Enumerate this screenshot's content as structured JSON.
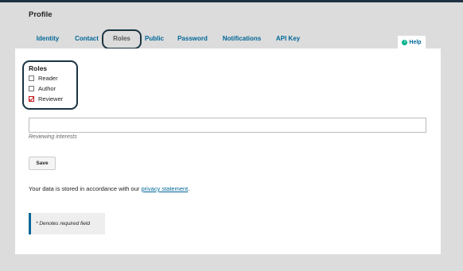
{
  "page": {
    "title": "Profile"
  },
  "tabs": [
    {
      "label": "Identity",
      "active": false
    },
    {
      "label": "Contact",
      "active": false
    },
    {
      "label": "Roles",
      "active": true
    },
    {
      "label": "Public",
      "active": false
    },
    {
      "label": "Password",
      "active": false
    },
    {
      "label": "Notifications",
      "active": false
    },
    {
      "label": "API Key",
      "active": false
    }
  ],
  "help": {
    "label": "Help",
    "icon": "info-icon"
  },
  "roles": {
    "title": "Roles",
    "items": [
      {
        "label": "Reader",
        "checked": false
      },
      {
        "label": "Author",
        "checked": false
      },
      {
        "label": "Reviewer",
        "checked": true
      }
    ]
  },
  "interests": {
    "value": "",
    "label": "Reviewing interests"
  },
  "form": {
    "save_label": "Save"
  },
  "privacy": {
    "prefix": "Your data is stored in accordance with our ",
    "link_text": "privacy statement",
    "suffix": "."
  },
  "required_note": "* Denotes required field",
  "colors": {
    "link": "#006798",
    "highlight": "#1a3442",
    "check": "#c4161c"
  }
}
